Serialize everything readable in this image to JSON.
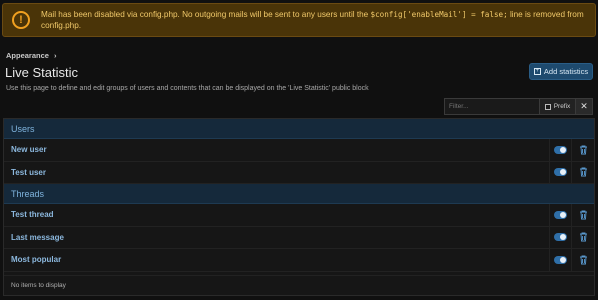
{
  "alert": {
    "text_before": "Mail has been disabled via config.php. No outgoing mails will be sent to any users until the ",
    "code": "$config['enableMail'] = false;",
    "text_after": " line is removed from config.php.",
    "icon": "exclamation-circle-icon",
    "color": "#f0a020"
  },
  "breadcrumb": {
    "item": "Appearance",
    "separator": "›"
  },
  "page": {
    "title": "Live Statistic",
    "description": "Use this page to define and edit groups of users and contents that can be displayed on the 'Live Statistic' public block"
  },
  "add_button": {
    "label": "Add statistics",
    "icon": "plus-square-icon"
  },
  "filter": {
    "placeholder": "Filter...",
    "prefix_label": "Prefix",
    "clear_icon": "close-icon"
  },
  "groups": [
    {
      "title": "Users",
      "items": [
        {
          "label": "New user",
          "enabled": true
        },
        {
          "label": "Test user",
          "enabled": true
        }
      ]
    },
    {
      "title": "Threads",
      "items": [
        {
          "label": "Test thread",
          "enabled": true
        },
        {
          "label": "Last message",
          "enabled": true
        },
        {
          "label": "Most popular",
          "enabled": true
        }
      ]
    }
  ],
  "footer": {
    "text": "No items to display"
  },
  "colors": {
    "accent": "#2f6fa8",
    "group_header": "#15293b",
    "link": "#8cb8de",
    "background": "#101010"
  }
}
